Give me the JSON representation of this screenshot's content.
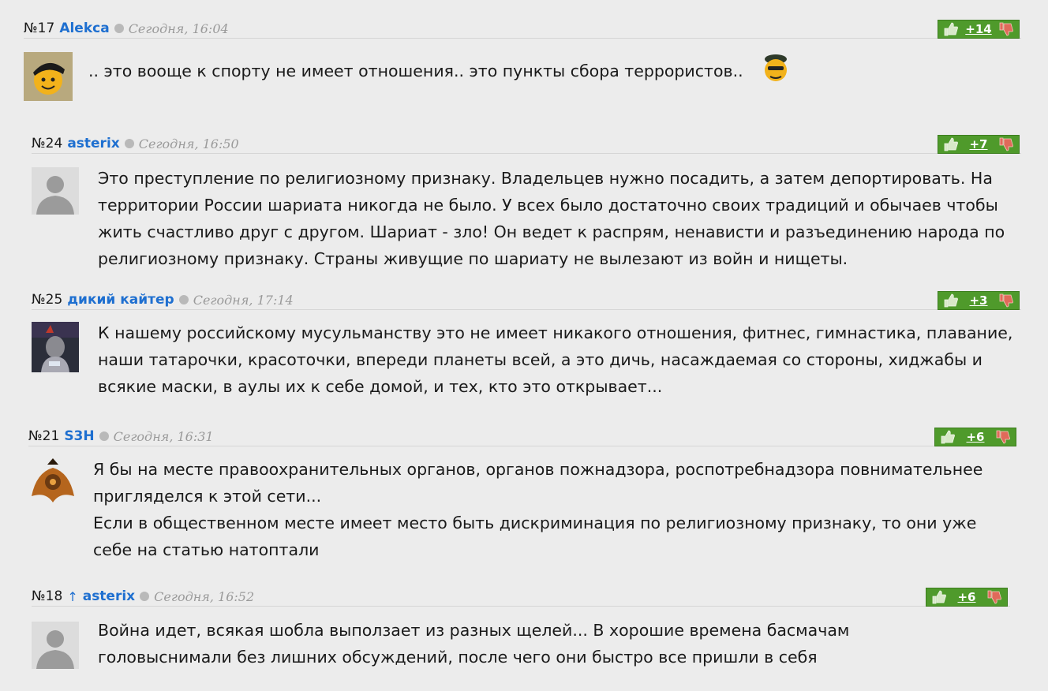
{
  "comments": [
    {
      "num": "№17",
      "author": "Alekca",
      "reply_arrow": "",
      "date": "Сегодня, 16:04",
      "score": "+14",
      "text": [
        ".. это вооще к спорту не имеет отношения.. это пункты сбора террористов.."
      ],
      "avatar_icon": "smiley-cap-avatar",
      "emoji_icon": "smiley-soldier-emoji"
    },
    {
      "num": "№24",
      "author": "asterix",
      "reply_arrow": "",
      "date": "Сегодня, 16:50",
      "score": "+7",
      "text": [
        "Это преступление по религиозному признаку. Владельцев нужно посадить, а затем депортировать. На территории России шариата никогда не было. У всех было достаточно своих традиций и обычаев чтобы жить счастливо друг с другом. Шариат - зло! Он ведет к распрям, ненависти и разъединению народа по религиозному признаку. Страны живущие по шариату не вылезают из войн и нищеты."
      ],
      "avatar_icon": "default-user-avatar"
    },
    {
      "num": "№25",
      "author": "дикий кайтер",
      "reply_arrow": "",
      "date": "Сегодня, 17:14",
      "score": "+3",
      "text": [
        "К нашему российскому мусульманству это не имеет никакого отношения, фитнес, гимнастика, плавание, наши татарочки, красоточки, впереди планеты всей, а это дичь, насаждаемая со стороны, хиджабы и всякие маски, в аулы их к себе домой, и тех, кто это открывает..."
      ],
      "avatar_icon": "photo-avatar"
    },
    {
      "num": "№21",
      "author": "S3H",
      "reply_arrow": "",
      "date": "Сегодня, 16:31",
      "score": "+6",
      "text": [
        "Я бы на месте правоохранительных органов, органов пожнадзора, роспотребнадзора повнимательнее пригляделся к этой сети...",
        "Если в общественном месте имеет место быть дискриминация по религиозному признаку, то они уже себе на статью натоптали"
      ],
      "avatar_icon": "emblem-avatar"
    },
    {
      "num": "№18",
      "author": "asterix",
      "reply_arrow": "↑",
      "date": "Сегодня, 16:52",
      "score": "+6",
      "text": [
        "Война идет, всякая шобла выползает из разных щелей... В хорошие времена басмачам головыснимали без лишних обсуждений, после чего они быстро все пришли в себя"
      ],
      "avatar_icon": "default-user-avatar"
    }
  ],
  "colors": {
    "author": "#1e6fd0",
    "vote_bg": "#4f9a2b",
    "thumb_up": "#d8e8c8",
    "thumb_down": "#e06a5a",
    "background": "#ececec"
  }
}
